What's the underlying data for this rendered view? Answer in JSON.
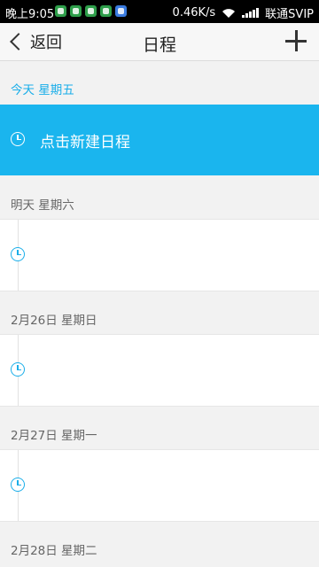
{
  "status_bar": {
    "time": "晚上9:05",
    "speed": "0.46K/s",
    "carrier": "联通SVIP",
    "app_icons": [
      "notification-icon",
      "wechat-icon",
      "wechat-icon",
      "wechat-icon",
      "app-icon"
    ]
  },
  "header": {
    "back_label": "返回",
    "title": "日程"
  },
  "days": {
    "today": {
      "label": "今天  星期五",
      "new_event_label": "点击新建日程"
    },
    "d1": {
      "label": "明天  星期六"
    },
    "d2": {
      "label": "2月26日  星期日"
    },
    "d3": {
      "label": "2月27日  星期一"
    },
    "d4": {
      "label": "2月28日  星期二"
    }
  },
  "colors": {
    "accent": "#1ab5ee",
    "background": "#f2f2f2"
  }
}
